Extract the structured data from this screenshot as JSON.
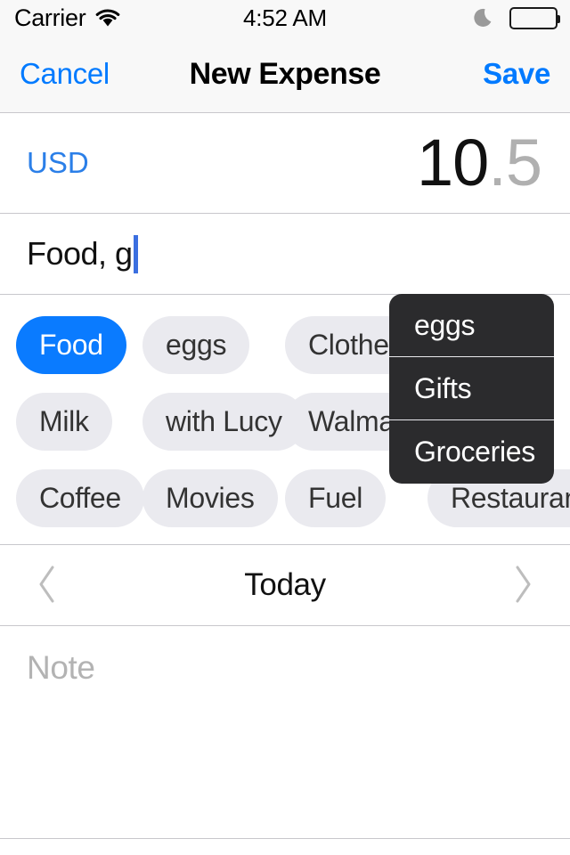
{
  "status_bar": {
    "carrier": "Carrier",
    "wifi_icon": "wifi-icon",
    "time": "4:52 AM",
    "dnd_icon": "moon-icon",
    "battery_icon": "battery-full-icon"
  },
  "nav_bar": {
    "cancel_label": "Cancel",
    "title": "New Expense",
    "save_label": "Save",
    "accent_color": "#007aff"
  },
  "amount": {
    "currency_label": "USD",
    "integer_part": "10",
    "decimal_part": ".5",
    "full_value": "10.5"
  },
  "title_field": {
    "value": "Food, g",
    "caret_visible": true
  },
  "tags": {
    "rows": [
      [
        {
          "label": "Food",
          "selected": true
        },
        {
          "label": "eggs",
          "selected": false
        },
        {
          "label": "Clothes",
          "selected": false
        }
      ],
      [
        {
          "label": "Milk",
          "selected": false
        },
        {
          "label": "with Lucy",
          "selected": false
        },
        {
          "label": "Walmart",
          "selected": false
        }
      ],
      [
        {
          "label": "Coffee",
          "selected": false
        },
        {
          "label": "Movies",
          "selected": false
        },
        {
          "label": "Fuel",
          "selected": false
        },
        {
          "label": "Restaurant",
          "selected": false
        }
      ]
    ],
    "selected_color": "#0a7bff",
    "unselected_color": "#eaeaef"
  },
  "autocomplete": {
    "visible": true,
    "background_color": "#2b2b2d",
    "items": [
      {
        "label": "eggs"
      },
      {
        "label": "Gifts"
      },
      {
        "label": "Groceries"
      }
    ]
  },
  "date": {
    "prev_icon": "chevron-left-icon",
    "label": "Today",
    "next_icon": "chevron-right-icon"
  },
  "note": {
    "placeholder": "Note",
    "value": ""
  }
}
